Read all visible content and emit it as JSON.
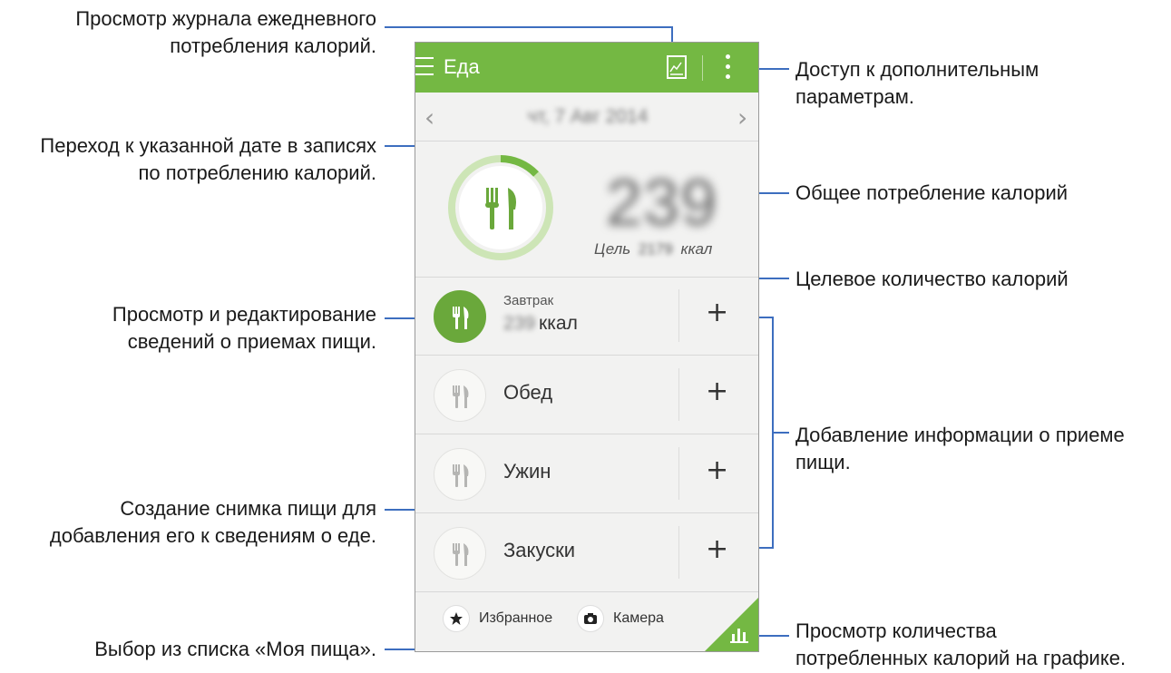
{
  "app": {
    "title": "Еда",
    "date": "чт, 7 Авг 2014",
    "total_calories": "239",
    "goal_prefix": "Цель",
    "goal_value": "2179",
    "goal_unit": "ккал",
    "meals": [
      {
        "name": "Завтрак",
        "calories": "239",
        "unit": "ккал",
        "active": true
      },
      {
        "name": "Обед",
        "active": false
      },
      {
        "name": "Ужин",
        "active": false
      },
      {
        "name": "Закуски",
        "active": false
      }
    ],
    "add_symbol": "+",
    "favorites_label": "Избранное",
    "camera_label": "Камера",
    "accent_color": "#74b843"
  },
  "callouts": {
    "log_line1": "Просмотр журнала ежедневного",
    "log_line2": "потребления калорий.",
    "date_line1": "Переход к указанной дате в записях",
    "date_line2": "по потреблению калорий.",
    "meal_line1": "Просмотр и редактирование",
    "meal_line2": "сведений о приемах пищи.",
    "photo_line1": "Создание снимка пищи для",
    "photo_line2": "добавления его к сведениям о еде.",
    "mylist": "Выбор из списка «Моя пища».",
    "more_line1": "Доступ к дополнительным",
    "more_line2": "параметрам.",
    "total": "Общее потребление калорий",
    "goal": "Целевое количество калорий",
    "add_line1": "Добавление информации о приеме",
    "add_line2": "пищи.",
    "graph_line1": "Просмотр количества",
    "graph_line2": "потребленных калорий на графике."
  }
}
